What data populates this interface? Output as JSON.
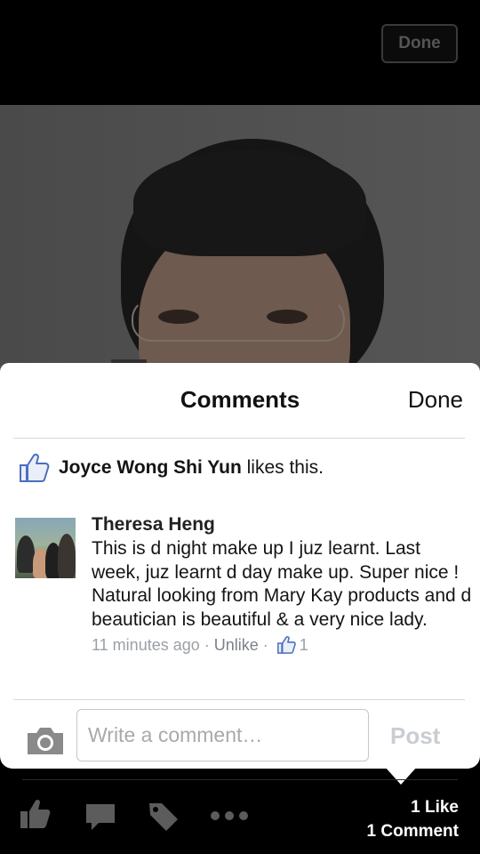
{
  "top_bar": {
    "done_label": "Done"
  },
  "comments_sheet": {
    "title": "Comments",
    "done_label": "Done",
    "likes": {
      "name": "Joyce Wong Shi Yun",
      "suffix": "likes this."
    },
    "comment": {
      "author": "Theresa Heng",
      "text": "This is d night make up I juz learnt. Last week, juz learnt d day make up. Super nice ! Natural looking from Mary Kay products and d beautician is beautiful & a very nice lady.",
      "time": "11 minutes ago",
      "separator": "·",
      "action_label": "Unlike",
      "like_count": "1"
    },
    "composer": {
      "placeholder": "Write a comment…",
      "post_label": "Post"
    }
  },
  "toolbar": {
    "icons": [
      "like-icon",
      "comment-icon",
      "tag-icon",
      "more-icon"
    ],
    "like_stat": "1 Like",
    "comment_stat": "1 Comment"
  },
  "colors": {
    "facebook_blue": "#4a6fbf",
    "muted_text": "#9aa0a6"
  }
}
